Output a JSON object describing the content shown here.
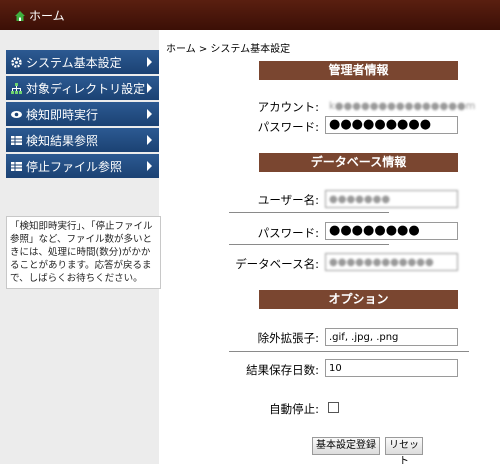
{
  "topbar": {
    "home_label": "ホーム"
  },
  "sidebar": {
    "items": [
      {
        "label": "システム基本設定",
        "icon": "gear-icon"
      },
      {
        "label": "対象ディレクトリ設定",
        "icon": "sitemap-icon"
      },
      {
        "label": "検知即時実行",
        "icon": "eye-icon"
      },
      {
        "label": "検知結果参照",
        "icon": "table-icon"
      },
      {
        "label": "停止ファイル参照",
        "icon": "table-icon"
      }
    ],
    "notice": "「検知即時実行」、「停止ファイル参照」など、ファイル数が多いときには、処理に時間(数分)がかかることがあります。応答が戻るまで、しばらくお待ちください。"
  },
  "breadcrumb": "ホーム > システム基本設定",
  "admin": {
    "header": "管理者情報",
    "account_label": "アカウント:",
    "account_value": "k●●●●●●●●●●●●●●●m",
    "password_label": "パスワード:",
    "password_value": "●●●●●●●●●"
  },
  "database": {
    "header": "データベース情報",
    "user_label": "ユーザー名:",
    "user_value": "●●●●●●●",
    "password_label": "パスワード:",
    "password_value": "●●●●●●●●",
    "dbname_label": "データベース名:",
    "dbname_value": "●●●●●●●●●●●●"
  },
  "options": {
    "header": "オプション",
    "exclude_label": "除外拡張子:",
    "exclude_value": ".gif, .jpg, .png",
    "retention_label": "結果保存日数:",
    "retention_value": "10",
    "autostop_label": "自動停止:"
  },
  "buttons": {
    "save": "基本設定登録",
    "reset": "リセット"
  },
  "colors": {
    "topbar": "#4a1608",
    "menu": "#24508a",
    "section_header": "#7a4630"
  }
}
